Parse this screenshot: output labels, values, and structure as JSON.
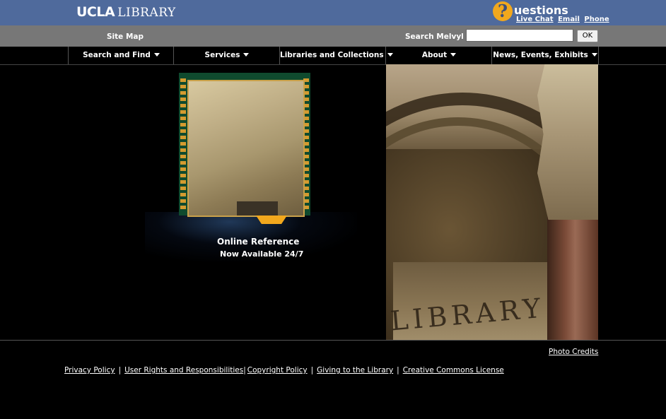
{
  "header": {
    "logo_ucla": "UCLA",
    "logo_library": "LIBRARY",
    "questions_mark": "?",
    "questions_label": "uestions",
    "links": [
      "Live Chat",
      "Email",
      "Phone"
    ]
  },
  "toolbar": {
    "site_map": "Site Map",
    "search_label": "Search Melvyl",
    "search_value": "",
    "ok_label": "OK"
  },
  "nav": {
    "items": [
      "Search and Find",
      "Services",
      "Libraries and Collections",
      "About",
      "News, Events, Exhibits"
    ]
  },
  "promo": {
    "title": "Online Reference",
    "subtitle": "Now Available 24/7"
  },
  "photo": {
    "carved_text": "LIBRARY"
  },
  "footer": {
    "photo_credits": "Photo Credits",
    "links": [
      "Privacy Policy",
      "User Rights and Responsibilities",
      "Copyright Policy",
      "Giving to the Library",
      "Creative Commons License"
    ],
    "separator": "|"
  },
  "colors": {
    "header_blue": "#4f6a9c",
    "toolbar_gray": "#777777",
    "accent_orange": "#f2a81d",
    "background": "#000000"
  }
}
